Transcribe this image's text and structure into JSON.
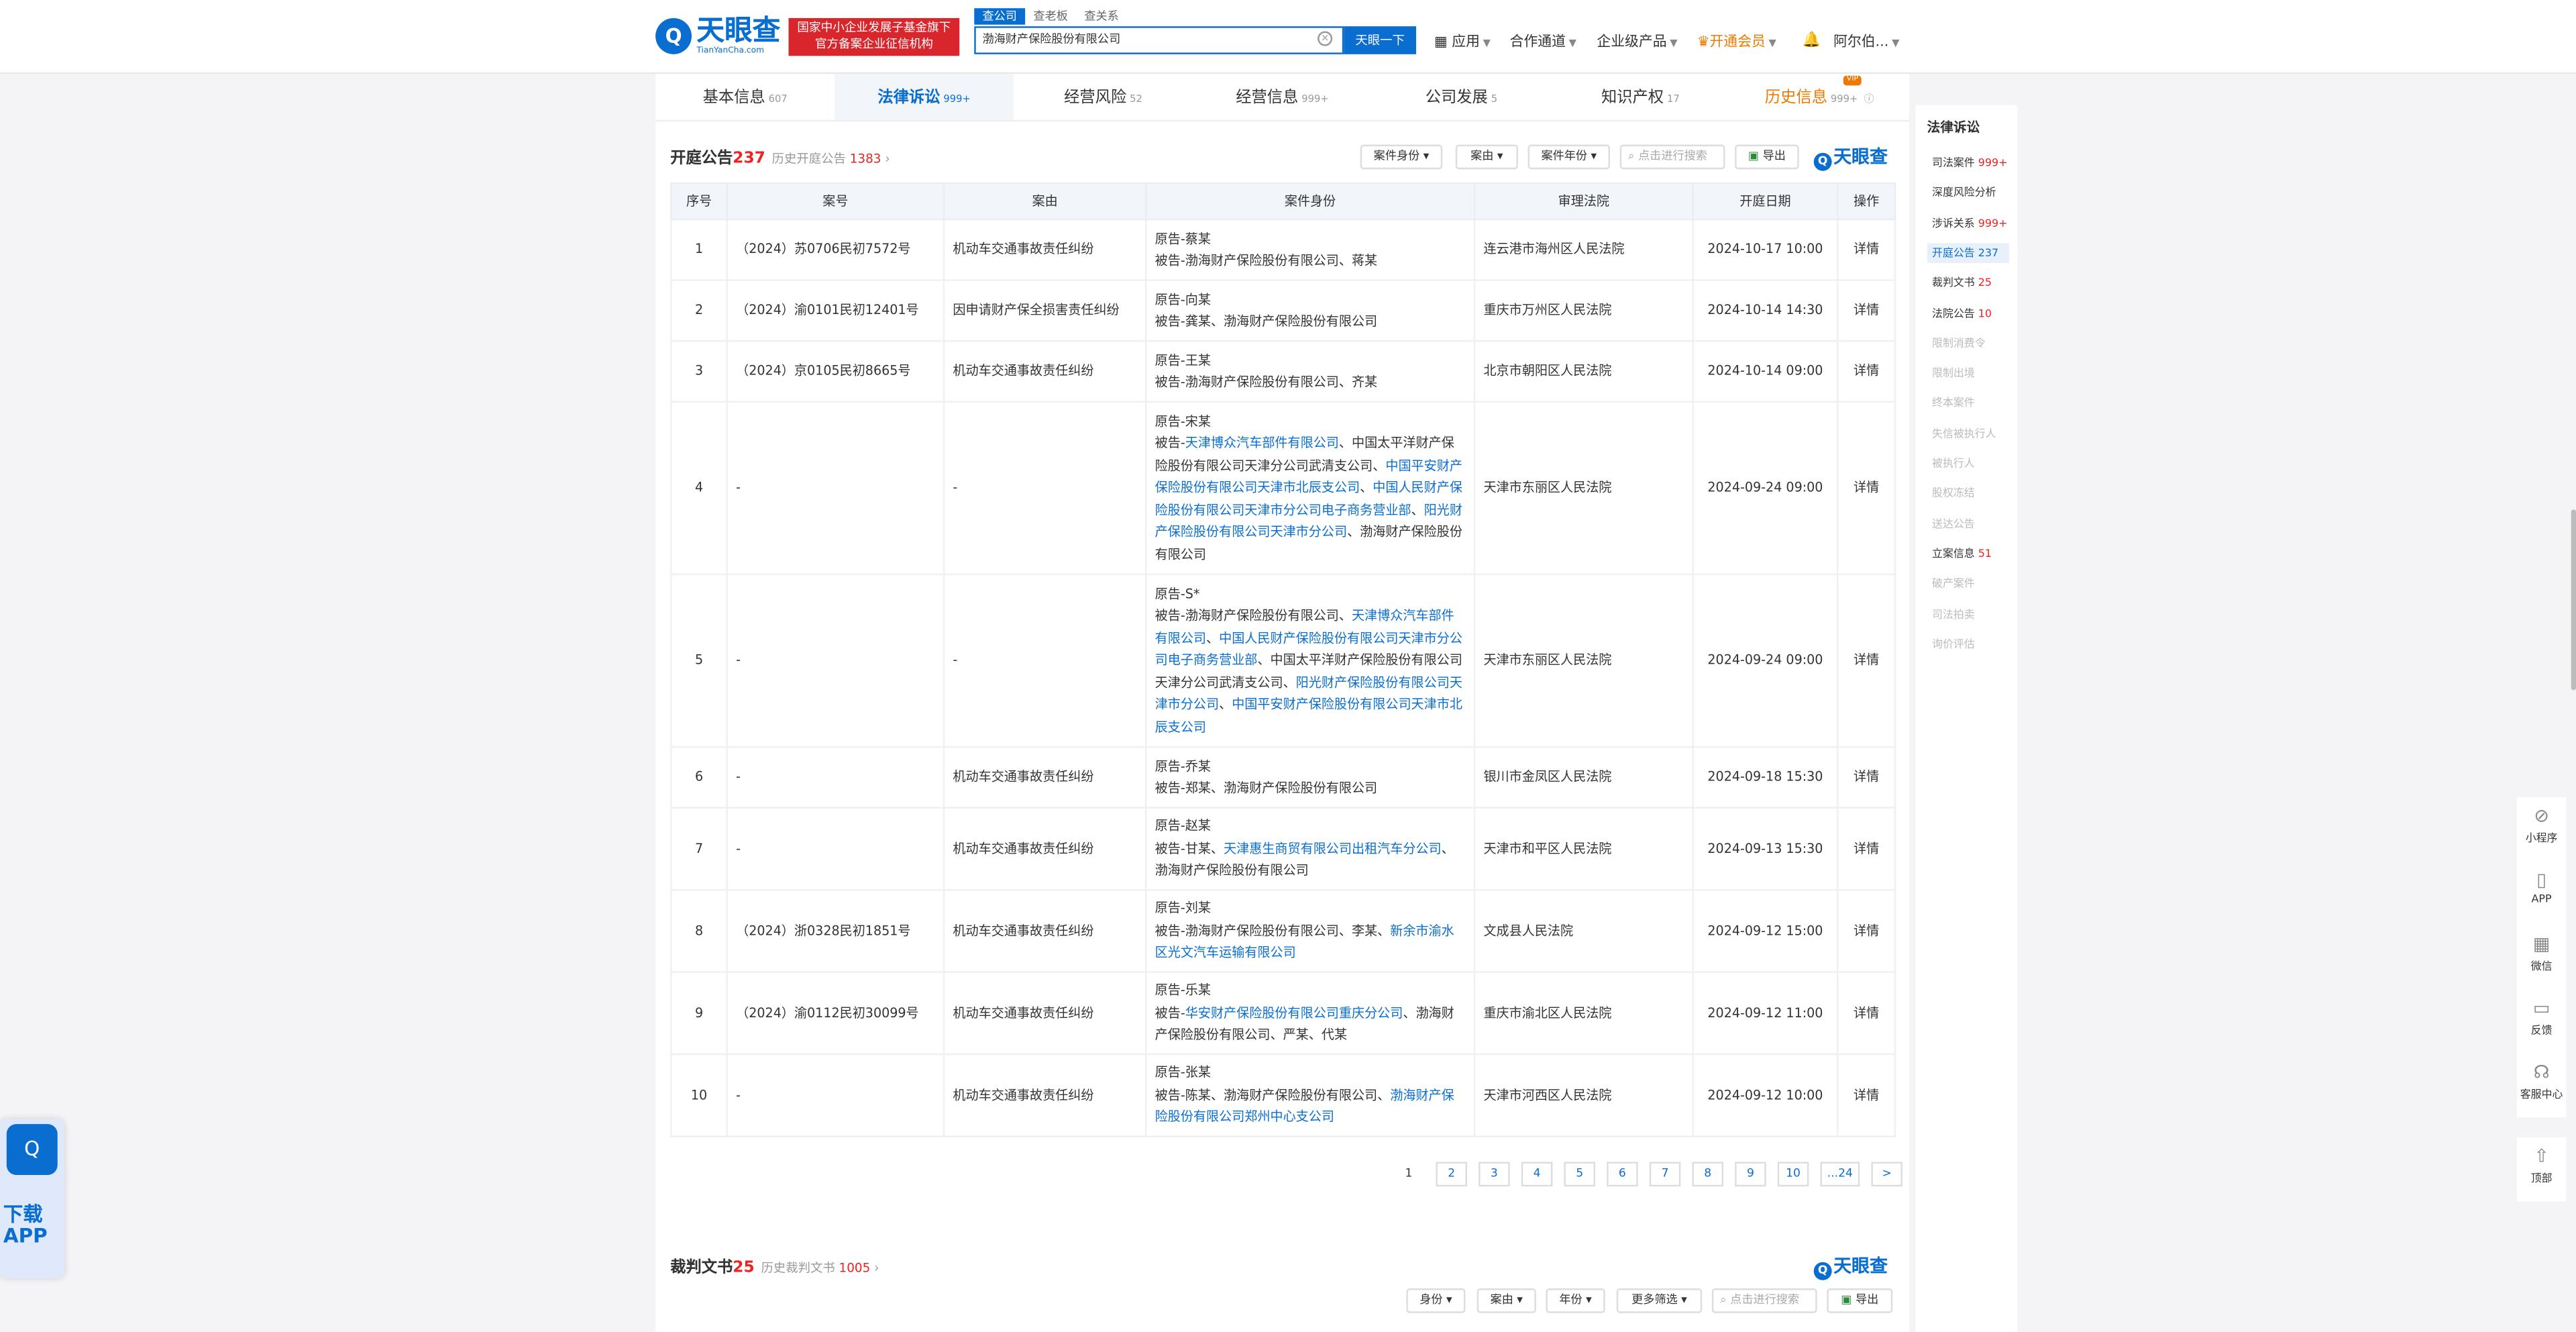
{
  "header": {
    "logo_cn": "天眼查",
    "logo_en": "TianYanCha.com",
    "badge_line1": "国家中小企业发展子基金旗下",
    "badge_line2": "官方备案企业征信机构",
    "search_tabs": [
      "查公司",
      "查老板",
      "查关系"
    ],
    "search_value": "渤海财产保险股份有限公司",
    "search_button": "天眼一下",
    "nav": [
      "应用",
      "合作通道",
      "企业级产品",
      "开通会员",
      "阿尔伯..."
    ]
  },
  "tabs": [
    {
      "label": "基本信息",
      "count": "607"
    },
    {
      "label": "法律诉讼",
      "count": "999+"
    },
    {
      "label": "经营风险",
      "count": "52"
    },
    {
      "label": "经营信息",
      "count": "999+"
    },
    {
      "label": "公司发展",
      "count": "5"
    },
    {
      "label": "知识产权",
      "count": "17"
    },
    {
      "label": "历史信息",
      "count": "999+",
      "badge": "VIP"
    }
  ],
  "section1": {
    "title": "开庭公告",
    "count": "237",
    "history_label": "历史开庭公告",
    "history_count": "1383",
    "filters": [
      "案件身份",
      "案由",
      "案件年份"
    ],
    "search_placeholder": "点击进行搜索",
    "export": "导出",
    "watermark": "天眼查",
    "columns": [
      "序号",
      "案号",
      "案由",
      "案件身份",
      "审理法院",
      "开庭日期",
      "操作"
    ],
    "rows": [
      {
        "no": "1",
        "case": "（2024）苏0706民初7572号",
        "reason": "机动车交通事故责任纠纷",
        "plaintiff": "原告-蔡某",
        "defendant": "被告-渤海财产保险股份有限公司、蒋某",
        "court": "连云港市海州区人民法院",
        "date": "2024-10-17 10:00",
        "op": "详情"
      },
      {
        "no": "2",
        "case": "（2024）渝0101民初12401号",
        "reason": "因申请财产保全损害责任纠纷",
        "plaintiff": "原告-向某",
        "defendant": "被告-龚某、渤海财产保险股份有限公司",
        "court": "重庆市万州区人民法院",
        "date": "2024-10-14 14:30",
        "op": "详情"
      },
      {
        "no": "3",
        "case": "（2024）京0105民初8665号",
        "reason": "机动车交通事故责任纠纷",
        "plaintiff": "原告-王某",
        "defendant": "被告-渤海财产保险股份有限公司、齐某",
        "court": "北京市朝阳区人民法院",
        "date": "2024-10-14 09:00",
        "op": "详情"
      },
      {
        "no": "4",
        "case": "-",
        "reason": "-",
        "plaintiff": "原告-宋某",
        "defendant_parts": [
          "被告-",
          "天津博众汽车部件有限公司",
          "、中国太平洋财产保险股份有限公司天津分公司武清支公司、",
          "中国平安财产保险股份有限公司天津市北辰支公司",
          "、",
          "中国人民财产保险股份有限公司天津市分公司电子商务营业部",
          "、",
          "阳光财产保险股份有限公司天津市分公司",
          "、渤海财产保险股份有限公司"
        ],
        "court": "天津市东丽区人民法院",
        "date": "2024-09-24 09:00",
        "op": "详情"
      },
      {
        "no": "5",
        "case": "-",
        "reason": "-",
        "plaintiff": "原告-S*",
        "defendant_parts": [
          "被告-渤海财产保险股份有限公司、",
          "天津博众汽车部件有限公司",
          "、",
          "中国人民财产保险股份有限公司天津市分公司电子商务营业部",
          "、中国太平洋财产保险股份有限公司天津分公司武清支公司、",
          "阳光财产保险股份有限公司天津市分公司",
          "、",
          "中国平安财产保险股份有限公司天津市北辰支公司"
        ],
        "court": "天津市东丽区人民法院",
        "date": "2024-09-24 09:00",
        "op": "详情"
      },
      {
        "no": "6",
        "case": "-",
        "reason": "机动车交通事故责任纠纷",
        "plaintiff": "原告-乔某",
        "defendant": "被告-郑某、渤海财产保险股份有限公司",
        "court": "银川市金凤区人民法院",
        "date": "2024-09-18 15:30",
        "op": "详情"
      },
      {
        "no": "7",
        "case": "-",
        "reason": "机动车交通事故责任纠纷",
        "plaintiff": "原告-赵某",
        "defendant_parts": [
          "被告-甘某、",
          "天津惠生商贸有限公司出租汽车分公司",
          "、渤海财产保险股份有限公司"
        ],
        "court": "天津市和平区人民法院",
        "date": "2024-09-13 15:30",
        "op": "详情"
      },
      {
        "no": "8",
        "case": "（2024）浙0328民初1851号",
        "reason": "机动车交通事故责任纠纷",
        "plaintiff": "原告-刘某",
        "defendant_parts": [
          "被告-渤海财产保险股份有限公司、李某、",
          "新余市渝水区光文汽车运输有限公司"
        ],
        "court": "文成县人民法院",
        "date": "2024-09-12 15:00",
        "op": "详情"
      },
      {
        "no": "9",
        "case": "（2024）渝0112民初30099号",
        "reason": "机动车交通事故责任纠纷",
        "plaintiff": "原告-乐某",
        "defendant_parts": [
          "被告-",
          "华安财产保险股份有限公司重庆分公司",
          "、渤海财产保险股份有限公司、严某、代某"
        ],
        "court": "重庆市渝北区人民法院",
        "date": "2024-09-12 11:00",
        "op": "详情"
      },
      {
        "no": "10",
        "case": "-",
        "reason": "机动车交通事故责任纠纷",
        "plaintiff": "原告-张某",
        "defendant_parts": [
          "被告-陈某、渤海财产保险股份有限公司、",
          "渤海财产保险股份有限公司郑州中心支公司"
        ],
        "court": "天津市河西区人民法院",
        "date": "2024-09-12 10:00",
        "op": "详情"
      }
    ],
    "pages": [
      "1",
      "2",
      "3",
      "4",
      "5",
      "6",
      "7",
      "8",
      "9",
      "10",
      "...24",
      ">"
    ]
  },
  "section2": {
    "title": "裁判文书",
    "count": "25",
    "history_label": "历史裁判文书",
    "history_count": "1005",
    "filters": [
      "身份",
      "案由",
      "年份",
      "更多筛选"
    ],
    "search_placeholder": "点击进行搜索",
    "export": "导出",
    "watermark": "天眼查"
  },
  "right_panel": {
    "title": "法律诉讼",
    "items": [
      {
        "label": "司法案件",
        "count": "999+"
      },
      {
        "label": "深度风险分析",
        "count": ""
      },
      {
        "label": "涉诉关系",
        "count": "999+"
      },
      {
        "label": "开庭公告",
        "count": "237",
        "active": true
      },
      {
        "label": "裁判文书",
        "count": "25"
      },
      {
        "label": "法院公告",
        "count": "10"
      },
      {
        "label": "限制消费令",
        "dis": true
      },
      {
        "label": "限制出境",
        "dis": true
      },
      {
        "label": "终本案件",
        "dis": true
      },
      {
        "label": "失信被执行人",
        "dis": true
      },
      {
        "label": "被执行人",
        "dis": true
      },
      {
        "label": "股权冻结",
        "dis": true
      },
      {
        "label": "送达公告",
        "dis": true
      },
      {
        "label": "立案信息",
        "count": "51"
      },
      {
        "label": "破产案件",
        "dis": true
      },
      {
        "label": "司法拍卖",
        "dis": true
      },
      {
        "label": "询价评估",
        "dis": true
      }
    ]
  },
  "side_tools": [
    "小程序",
    "APP",
    "微信",
    "反馈",
    "客服中心",
    "顶部"
  ],
  "download": {
    "line1": "下载",
    "line2": "APP"
  }
}
